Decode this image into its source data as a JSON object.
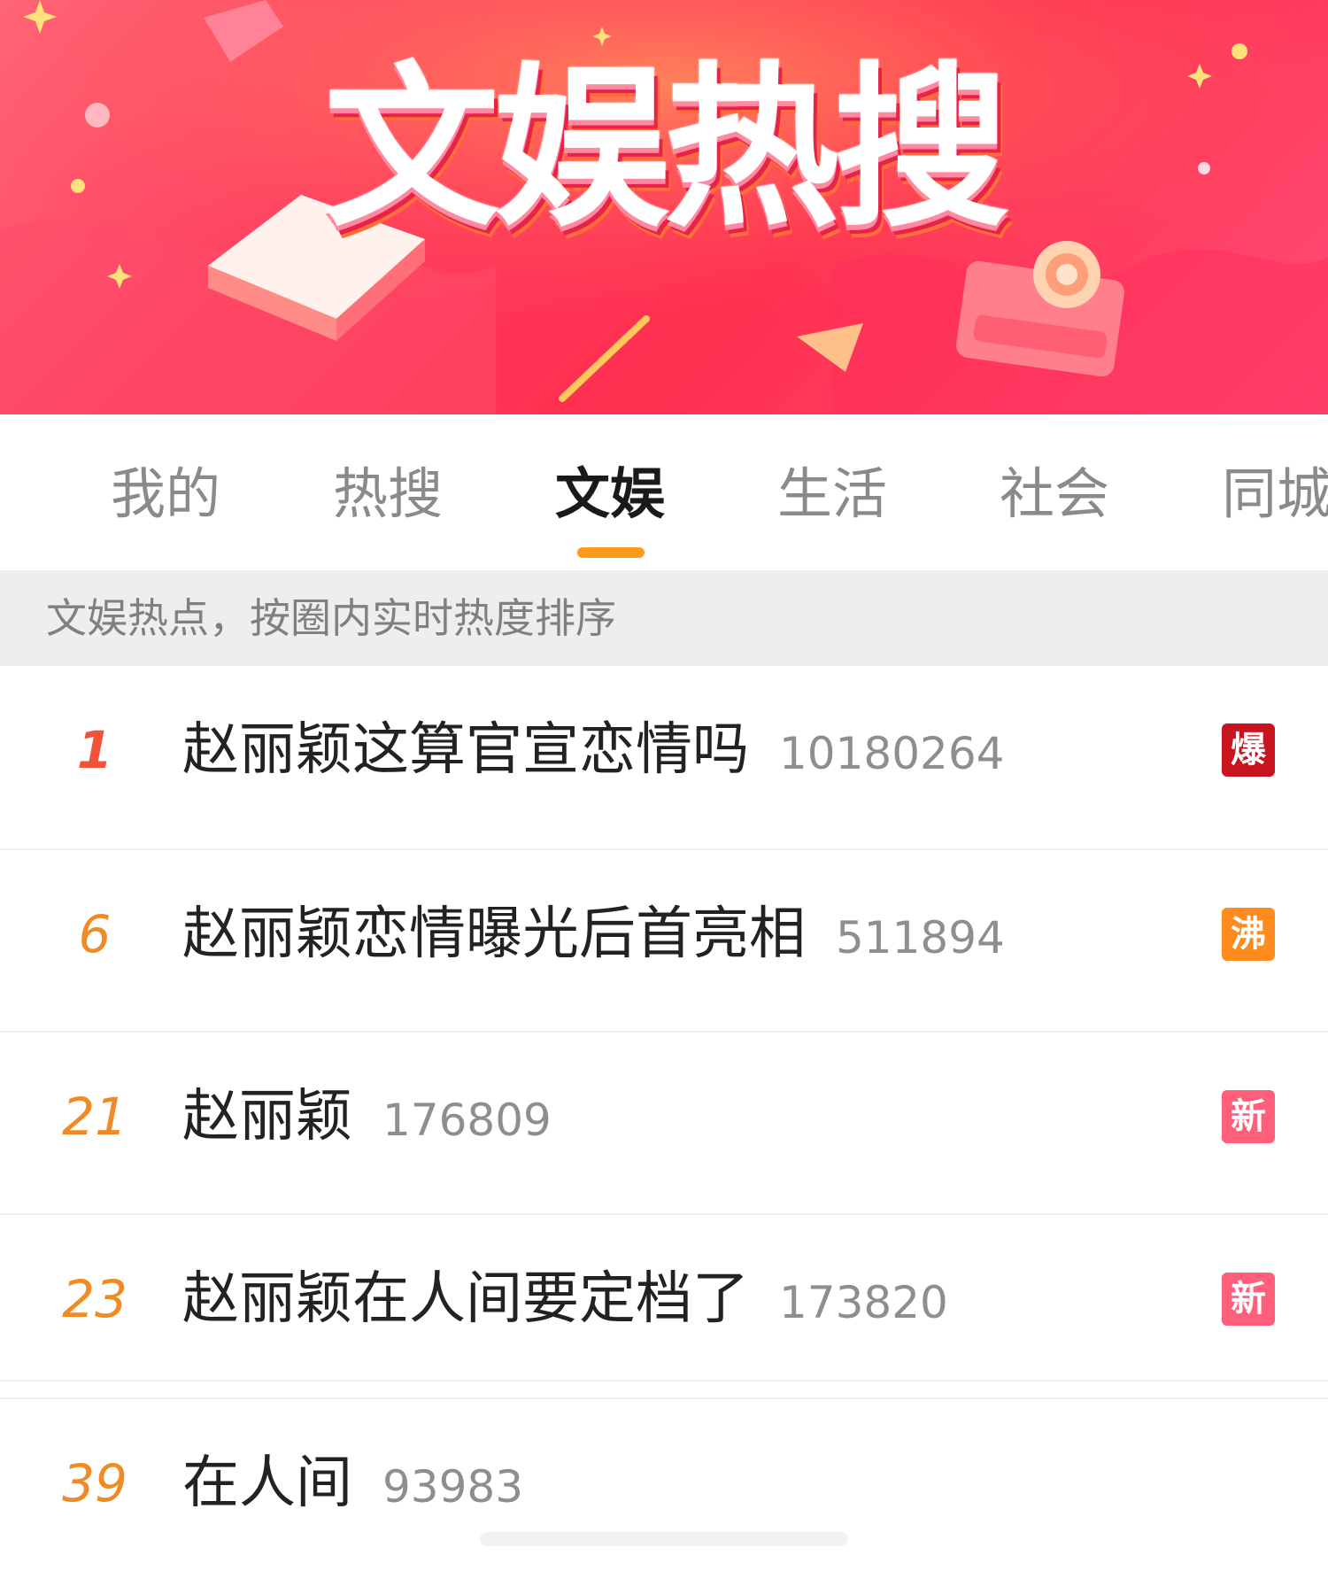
{
  "banner": {
    "title": "文娱热搜"
  },
  "tabs": [
    {
      "label": "我的",
      "active": false
    },
    {
      "label": "热搜",
      "active": false
    },
    {
      "label": "文娱",
      "active": true
    },
    {
      "label": "生活",
      "active": false
    },
    {
      "label": "社会",
      "active": false
    },
    {
      "label": "同城",
      "active": false
    }
  ],
  "subheader": {
    "text": "文娱热点，按圈内实时热度排序"
  },
  "list": [
    {
      "rank": "1",
      "title": "赵丽颖这算官宣恋情吗",
      "count": "10180264",
      "badge": "爆",
      "badge_color": "#c8141e"
    },
    {
      "rank": "6",
      "title": "赵丽颖恋情曝光后首亮相",
      "count": "511894",
      "badge": "沸",
      "badge_color": "#ff8a1e"
    },
    {
      "rank": "21",
      "title": "赵丽颖",
      "count": "176809",
      "badge": "新",
      "badge_color": "#ff5f7a"
    },
    {
      "rank": "23",
      "title": "赵丽颖在人间要定档了",
      "count": "173820",
      "badge": "新",
      "badge_color": "#ff5f7a"
    },
    {
      "rank": "39",
      "title": "在人间",
      "count": "93983",
      "badge": "",
      "badge_color": ""
    }
  ],
  "colors": {
    "accent": "#ff9a1f",
    "rank_top": "#f0523a",
    "rank": "#f08a24"
  }
}
